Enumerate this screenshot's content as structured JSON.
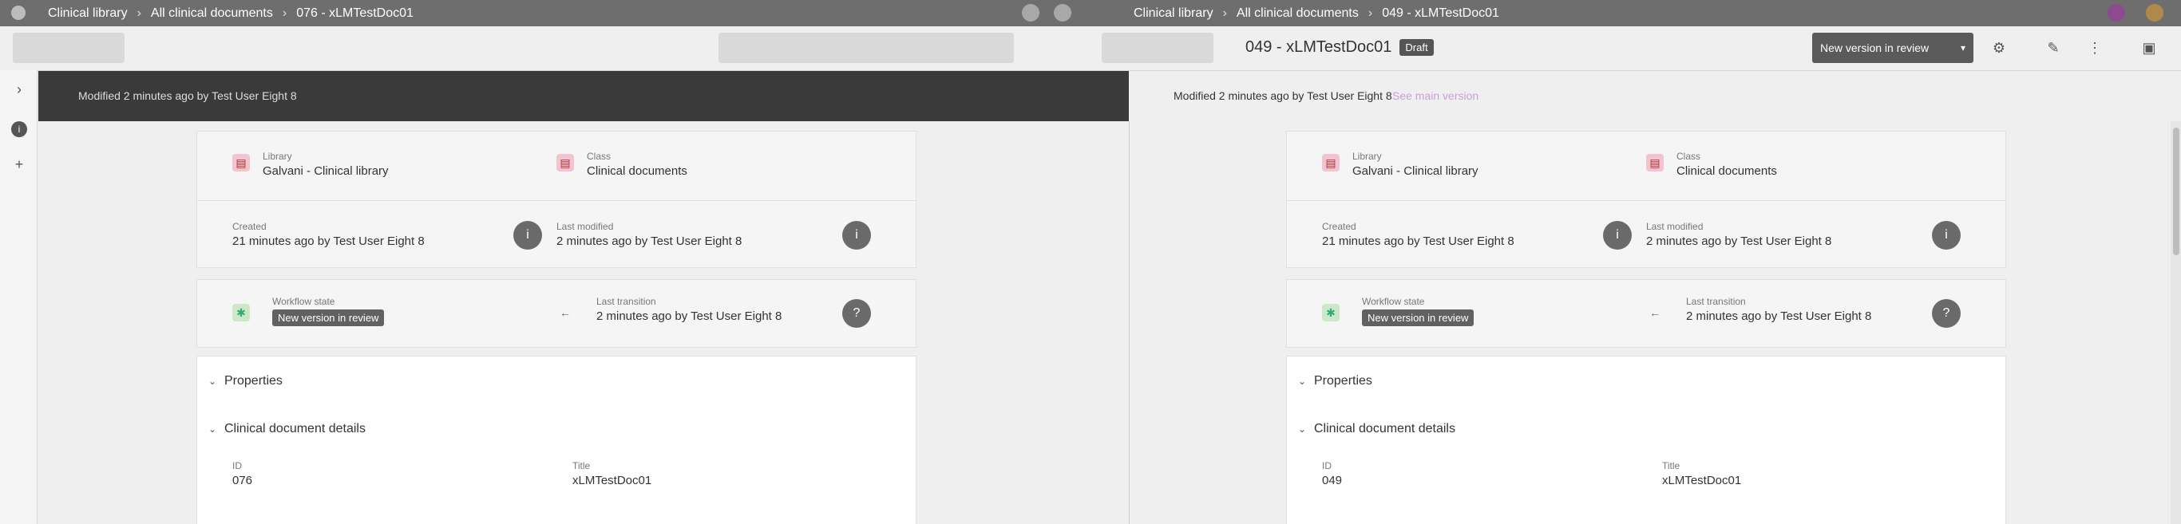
{
  "topbar": {
    "left_crumbs": [
      "Clinical library",
      "All clinical documents",
      "076 - xLMTestDoc01"
    ],
    "right_crumbs": [
      "Clinical library",
      "All clinical documents",
      "049 - xLMTestDoc01"
    ]
  },
  "toolbar2": {
    "doc_title": "049 - xLMTestDoc01",
    "doc_badge": "Draft",
    "status_label": "New version in review"
  },
  "compare_bar": {
    "left_info": "Modified 2 minutes ago by Test User Eight 8",
    "right_info": "Modified 2 minutes ago by Test User Eight 8",
    "right_link": "See main version"
  },
  "left_pane": {
    "library_label": "Library",
    "library_value": "Galvani - Clinical library",
    "class_label": "Class",
    "class_value": "Clinical documents",
    "created_label": "Created",
    "created_value": "21 minutes ago by Test User Eight 8",
    "modified_label": "Last modified",
    "modified_value": "2 minutes ago by Test User Eight 8",
    "workflow_label": "Workflow state",
    "workflow_value": "New version in review",
    "transition_label": "Last transition",
    "transition_value": "2 minutes ago by Test User Eight 8",
    "properties_label": "Properties",
    "details_label": "Clinical document details",
    "id_label": "ID",
    "id_value": "076",
    "title_label": "Title",
    "title_value": "xLMTestDoc01"
  },
  "right_pane": {
    "library_label": "Library",
    "library_value": "Galvani - Clinical library",
    "class_label": "Class",
    "class_value": "Clinical documents",
    "created_label": "Created",
    "created_value": "21 minutes ago by Test User Eight 8",
    "modified_label": "Last modified",
    "modified_value": "2 minutes ago by Test User Eight 8",
    "workflow_label": "Workflow state",
    "workflow_value": "New version in review",
    "transition_label": "Last transition",
    "transition_value": "2 minutes ago by Test User Eight 8",
    "properties_label": "Properties",
    "details_label": "Clinical document details",
    "id_label": "ID",
    "id_value": "049",
    "title_label": "Title",
    "title_value": "xLMTestDoc01"
  },
  "colors": {
    "topbar": "#6e6e6e",
    "compare_bar": "#3a3a3a",
    "accent": "#8e4a8e"
  }
}
